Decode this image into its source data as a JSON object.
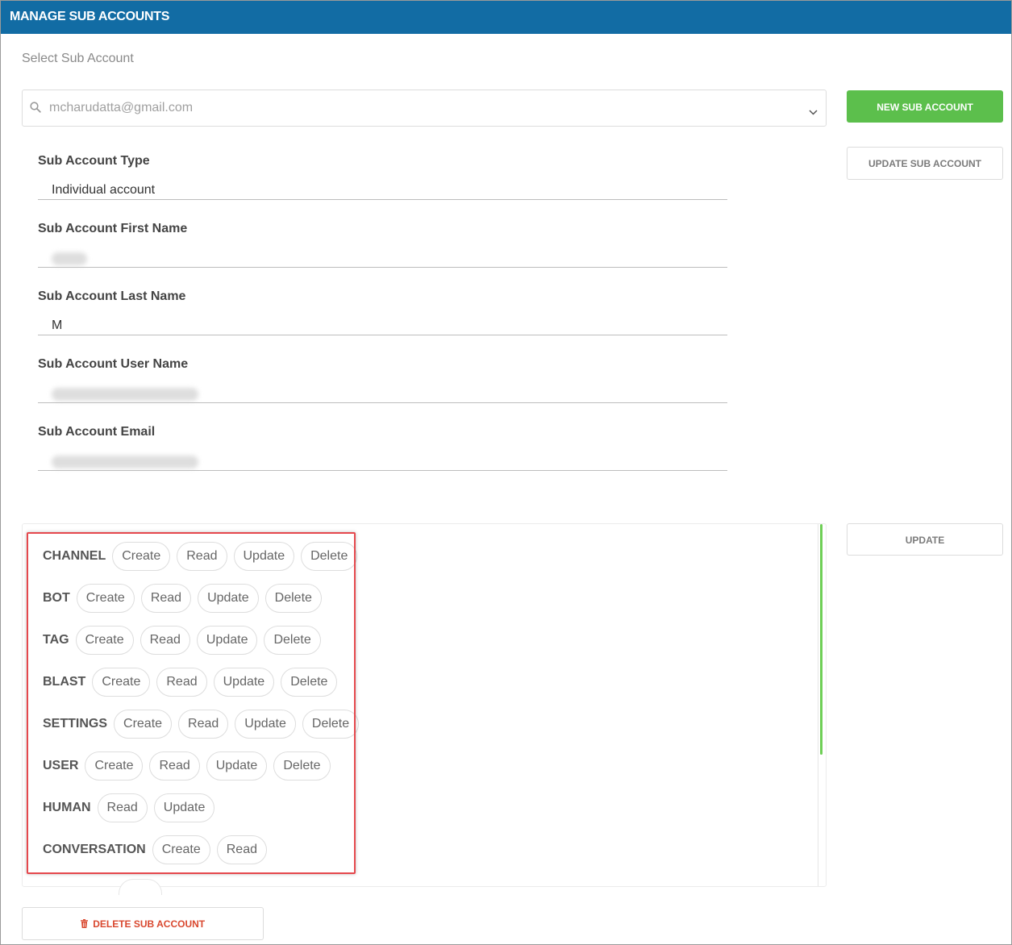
{
  "header": {
    "title": "MANAGE SUB ACCOUNTS"
  },
  "select": {
    "label": "Select Sub Account",
    "value": "mcharudatta@gmail.com",
    "search_icon": "search-icon",
    "chevron_icon": "chevron-down-icon"
  },
  "buttons": {
    "new_sub_account": "NEW SUB ACCOUNT",
    "update_sub_account": "UPDATE SUB ACCOUNT",
    "update": "UPDATE",
    "delete_sub_account": "DELETE SUB ACCOUNT"
  },
  "fields": {
    "type": {
      "label": "Sub Account Type",
      "value": "Individual account"
    },
    "first_name": {
      "label": "Sub Account First Name",
      "value": "",
      "redacted": true
    },
    "last_name": {
      "label": "Sub Account Last Name",
      "value": "M"
    },
    "user_name": {
      "label": "Sub Account User Name",
      "value": "",
      "redacted": true
    },
    "email": {
      "label": "Sub Account Email",
      "value": "",
      "redacted": true
    }
  },
  "permissions": [
    {
      "name": "CHANNEL",
      "actions": [
        "Create",
        "Read",
        "Update",
        "Delete"
      ]
    },
    {
      "name": "BOT",
      "actions": [
        "Create",
        "Read",
        "Update",
        "Delete"
      ]
    },
    {
      "name": "TAG",
      "actions": [
        "Create",
        "Read",
        "Update",
        "Delete"
      ]
    },
    {
      "name": "BLAST",
      "actions": [
        "Create",
        "Read",
        "Update",
        "Delete"
      ]
    },
    {
      "name": "SETTINGS",
      "actions": [
        "Create",
        "Read",
        "Update",
        "Delete"
      ]
    },
    {
      "name": "USER",
      "actions": [
        "Create",
        "Read",
        "Update",
        "Delete"
      ]
    },
    {
      "name": "HUMAN",
      "actions": [
        "Read",
        "Update"
      ]
    },
    {
      "name": "CONVERSATION",
      "actions": [
        "Create",
        "Read"
      ]
    }
  ],
  "colors": {
    "header_bg": "#126ca4",
    "primary_green": "#5cbf4c",
    "danger": "#d9482f",
    "highlight": "#e5484d"
  }
}
